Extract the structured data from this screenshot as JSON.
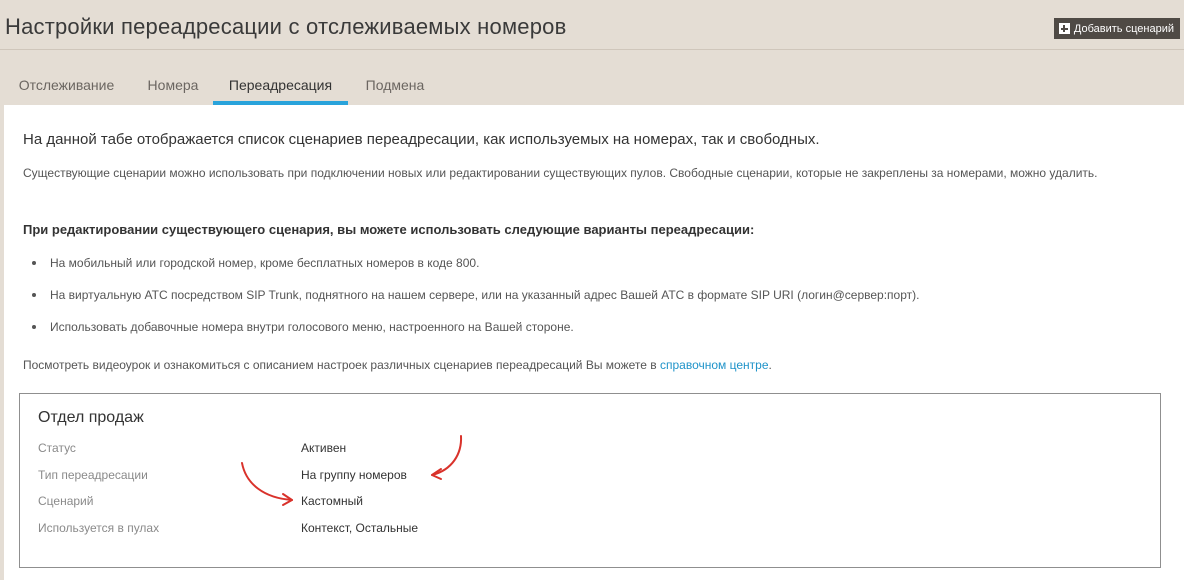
{
  "header": {
    "title": "Настройки переадресации с отслеживаемых номеров",
    "add_button_label": "Добавить сценарий",
    "add_button_icon": "plus-square-icon"
  },
  "tabs": [
    {
      "label": "Отслеживание",
      "active": false
    },
    {
      "label": "Номера",
      "active": false
    },
    {
      "label": "Переадресация",
      "active": true
    },
    {
      "label": "Подмена",
      "active": false
    }
  ],
  "main": {
    "intro": "На данной табе отображается список сценариев переадресации, как используемых на номерах, так и свободных.",
    "description": "Существующие сценарии можно использовать при подключении новых или редактировании существующих пулов. Свободные сценарии, которые не закреплены за номерами, можно удалить.",
    "subheading": "При редактировании существующего сценария, вы можете использовать следующие варианты переадресации:",
    "bullets": [
      "На мобильный или городской номер, кроме бесплатных номеров в коде 800.",
      "На виртуальную АТС посредством SIP Trunk, поднятного на нашем сервере, или на указанный адрес Вашей АТС в формате SIP URI (логин@сервер:порт).",
      "Использовать добавочные номера внутри голосового меню, настроенного на Вашей стороне."
    ],
    "help_text": "Посмотреть видеоурок и ознакомиться с описанием настроек различных сценариев переадресаций Вы можете в",
    "help_link": "справочном центре",
    "help_suffix": "."
  },
  "scenario_card": {
    "title": "Отдел продаж",
    "rows": [
      {
        "label": "Статус",
        "value": "Активен"
      },
      {
        "label": "Тип переадресации",
        "value": "На группу номеров"
      },
      {
        "label": "Сценарий",
        "value": "Кастомный"
      },
      {
        "label": "Используется в пулах",
        "value": "Контекст, Остальные"
      }
    ]
  },
  "colors": {
    "background": "#e4ddd4",
    "accent": "#29a3db",
    "link": "#1f93c9",
    "annotation_arrow": "#d9322b",
    "button": "#4f4a45"
  }
}
